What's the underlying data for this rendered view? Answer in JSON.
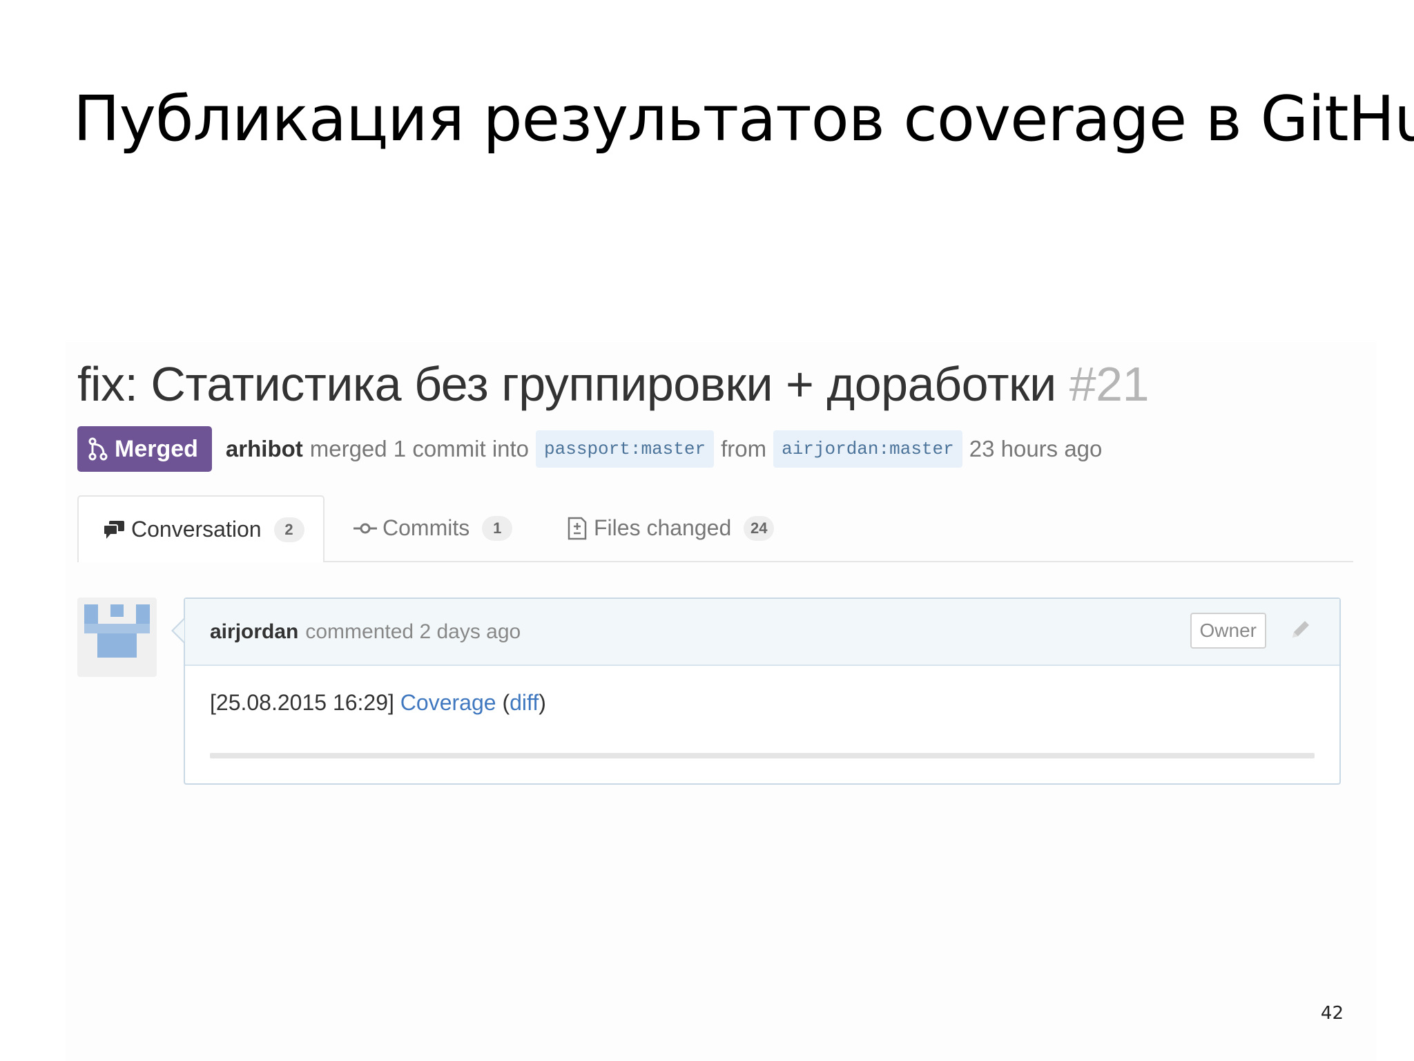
{
  "slide": {
    "title": "Публикация результатов coverage в GitHub",
    "page_number": "42"
  },
  "pull_request": {
    "title": "fix: Статистика без группировки + доработки",
    "number": "#21",
    "state": "Merged",
    "author": "arhibot",
    "merged_text": "merged 1 commit into",
    "base_branch": "passport:master",
    "from_text": "from",
    "head_branch": "airjordan:master",
    "time": "23 hours ago"
  },
  "tabs": [
    {
      "label": "Conversation",
      "count": "2",
      "icon": "comment-discussion-icon"
    },
    {
      "label": "Commits",
      "count": "1",
      "icon": "git-commit-icon"
    },
    {
      "label": "Files changed",
      "count": "24",
      "icon": "file-diff-icon"
    }
  ],
  "comment": {
    "author": "airjordan",
    "action": "commented 2 days ago",
    "role_badge": "Owner",
    "timestamp": "[25.08.2015 16:29]",
    "link_coverage": "Coverage",
    "paren_open": "(",
    "link_diff": "diff",
    "paren_close": ")"
  },
  "colors": {
    "merged_badge": "#6e5494",
    "link": "#4078c0",
    "branch_bg": "#e8f1fa",
    "comment_header_bg": "#f2f8fa"
  }
}
